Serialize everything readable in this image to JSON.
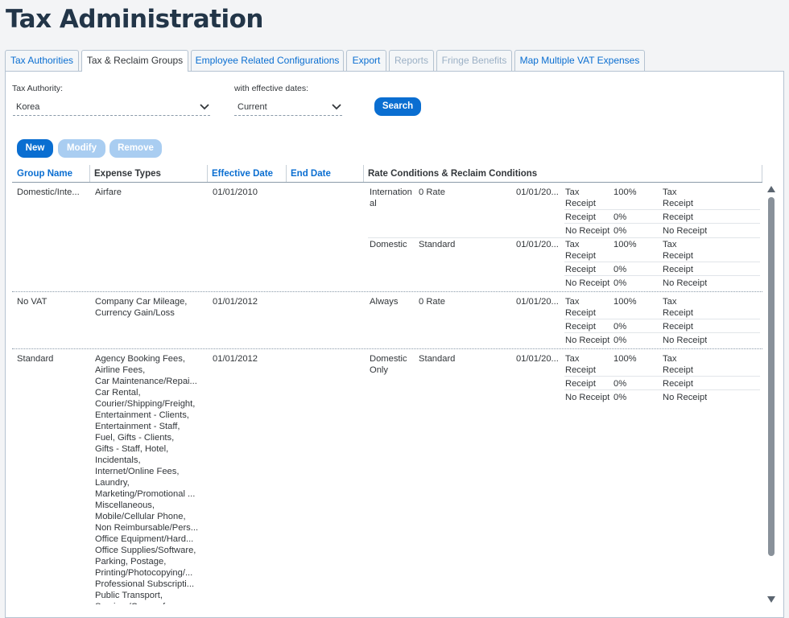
{
  "page": {
    "title": "Tax Administration"
  },
  "tabs": [
    {
      "label": "Tax Authorities",
      "state": "normal"
    },
    {
      "label": "Tax & Reclaim Groups",
      "state": "active"
    },
    {
      "label": "Employee Related Configurations",
      "state": "normal"
    },
    {
      "label": "Export",
      "state": "normal"
    },
    {
      "label": "Reports",
      "state": "disabled"
    },
    {
      "label": "Fringe Benefits",
      "state": "disabled"
    },
    {
      "label": "Map Multiple VAT Expenses",
      "state": "normal"
    }
  ],
  "filters": {
    "tax_authority_label": "Tax Authority:",
    "tax_authority_value": "Korea",
    "effective_label": "with effective dates:",
    "effective_value": "Current",
    "search_label": "Search"
  },
  "toolbar": {
    "new_label": "New",
    "modify_label": "Modify",
    "remove_label": "Remove"
  },
  "table": {
    "columns": [
      "Group Name",
      "Expense Types",
      "Effective Date",
      "End Date",
      "Rate Conditions & Reclaim Conditions"
    ],
    "rows": [
      {
        "group_name": "Domestic/Inte...",
        "expense_types": "Airfare",
        "effective_date": "01/01/2010",
        "end_date": "",
        "conditions": [
          {
            "name": "International",
            "rate": "0 Rate",
            "date": "01/01/20...",
            "receipts": [
              {
                "type": "Tax Receipt",
                "pct": "100%",
                "reclaim": "Tax Receipt"
              },
              {
                "type": "Receipt",
                "pct": "0%",
                "reclaim": "Receipt"
              },
              {
                "type": "No Receipt",
                "pct": "0%",
                "reclaim": "No Receipt"
              }
            ]
          },
          {
            "name": "Domestic",
            "rate": "Standard",
            "date": "01/01/20...",
            "receipts": [
              {
                "type": "Tax Receipt",
                "pct": "100%",
                "reclaim": "Tax Receipt"
              },
              {
                "type": "Receipt",
                "pct": "0%",
                "reclaim": "Receipt"
              },
              {
                "type": "No Receipt",
                "pct": "0%",
                "reclaim": "No Receipt"
              }
            ]
          }
        ]
      },
      {
        "group_name": "No VAT",
        "expense_types": "Company Car Mileage,\nCurrency Gain/Loss",
        "effective_date": "01/01/2012",
        "end_date": "",
        "conditions": [
          {
            "name": "Always",
            "rate": "0 Rate",
            "date": "01/01/20...",
            "receipts": [
              {
                "type": "Tax Receipt",
                "pct": "100%",
                "reclaim": "Tax Receipt"
              },
              {
                "type": "Receipt",
                "pct": "0%",
                "reclaim": "Receipt"
              },
              {
                "type": "No Receipt",
                "pct": "0%",
                "reclaim": "No Receipt"
              }
            ]
          }
        ]
      },
      {
        "group_name": "Standard",
        "expense_types": [
          "Agency Booking Fees,",
          "Airline Fees,",
          "Car Maintenance/Repai...",
          "Car Rental,",
          "Courier/Shipping/Freight,",
          "Entertainment - Clients,",
          "Entertainment - Staff,",
          "Fuel, Gifts - Clients,",
          "Gifts - Staff, Hotel,",
          "Incidentals,",
          "Internet/Online Fees,",
          "Laundry,",
          "Marketing/Promotional ...",
          "Miscellaneous,",
          "Mobile/Cellular Phone,",
          "Non Reimbursable/Pers...",
          "Office Equipment/Hard...",
          "Office Supplies/Software,",
          "Parking, Postage,",
          "Printing/Photocopying/...",
          "Professional Subscripti...",
          "Public Transport,",
          "Seminar/Course fees"
        ],
        "effective_date": "01/01/2012",
        "end_date": "",
        "conditions": [
          {
            "name": "Domestic Only",
            "rate": "Standard",
            "date": "01/01/20...",
            "receipts": [
              {
                "type": "Tax Receipt",
                "pct": "100%",
                "reclaim": "Tax Receipt"
              },
              {
                "type": "Receipt",
                "pct": "0%",
                "reclaim": "Receipt"
              },
              {
                "type": "No Receipt",
                "pct": "0%",
                "reclaim": "No Receipt"
              }
            ]
          }
        ]
      }
    ]
  },
  "icons": {
    "dropdown": "chevron-down-icon",
    "scroll_up": "triangle-up-icon",
    "scroll_down": "triangle-down-icon"
  },
  "colors": {
    "accent": "#0a6ed1",
    "title": "#223548",
    "disabled": "#a9cdf1"
  }
}
